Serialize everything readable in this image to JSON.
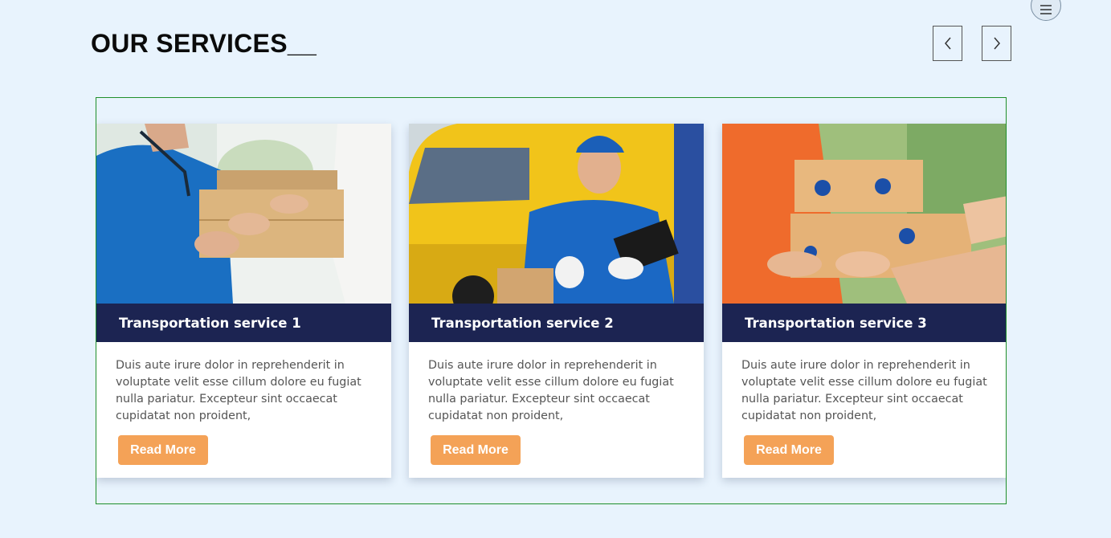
{
  "header": {
    "title": "OUR SERVICES__"
  },
  "nav": {
    "menu_icon": "hamburger-menu-icon",
    "prev_icon": "chevron-left-icon",
    "next_icon": "chevron-right-icon"
  },
  "colors": {
    "background": "#e8f3fd",
    "card_header": "#1c2452",
    "button": "#f4a257",
    "carousel_border": "#1f8f2a"
  },
  "services": [
    {
      "title": "Transportation service 1",
      "description": "Duis aute irure dolor in reprehenderit in voluptate velit esse cillum dolore eu fugiat nulla pariatur. Excepteur sint occaecat cupidatat non proident,",
      "button": "Read More"
    },
    {
      "title": "Transportation service 2",
      "description": "Duis aute irure dolor in reprehenderit in voluptate velit esse cillum dolore eu fugiat nulla pariatur. Excepteur sint occaecat cupidatat non proident,",
      "button": "Read More"
    },
    {
      "title": "Transportation service 3",
      "description": "Duis aute irure dolor in reprehenderit in voluptate velit esse cillum dolore eu fugiat nulla pariatur. Excepteur sint occaecat cupidatat non proident,",
      "button": "Read More"
    }
  ]
}
